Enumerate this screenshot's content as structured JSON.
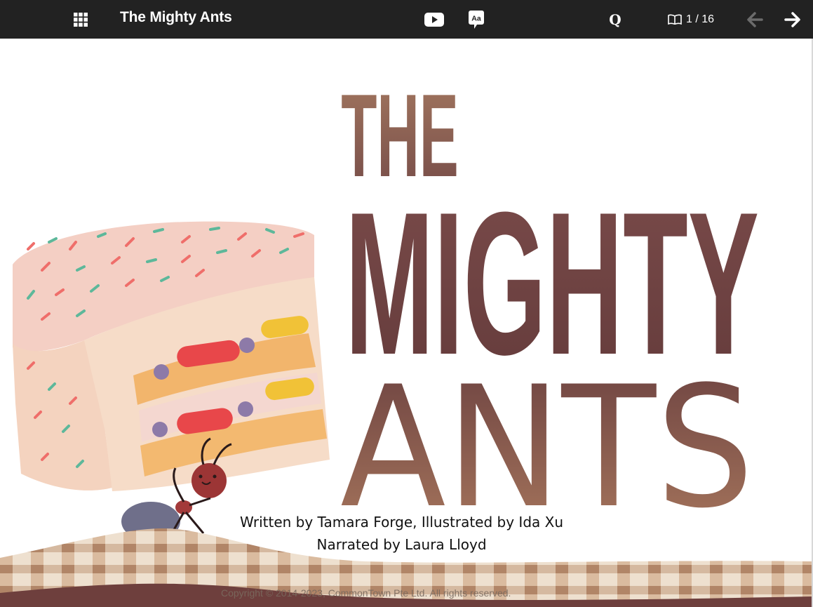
{
  "toolbar": {
    "title": "The Mighty Ants",
    "grid_icon": "grid-icon",
    "video_icon": "play-video-icon",
    "font_icon": "font-size-icon",
    "font_label": "Aa",
    "search_label": "Q",
    "page_icon": "open-book-icon",
    "page_current": "1",
    "page_total": "16",
    "page_indicator": "1 / 16",
    "prev_icon": "arrow-left-icon",
    "next_icon": "arrow-right-icon"
  },
  "cover": {
    "title_line_1": "THE",
    "title_line_2": "MIGHTY",
    "title_line_3": "ANTS",
    "credit_authors": "Written by Tamara Forge, Illustrated by Ida Xu",
    "credit_narrator": "Narrated by Laura Lloyd",
    "copyright": "Copyright © 2014-2023, CommonTown Pte Ltd. All rights reserved."
  },
  "colors": {
    "toolbar_bg": "#222222",
    "title_brown": "#7a4a44",
    "title_brown_light": "#a97a5e",
    "cake_pink": "#f3cdc2",
    "cake_sponge": "#f4b972",
    "tablecloth": "#c9a27f"
  }
}
